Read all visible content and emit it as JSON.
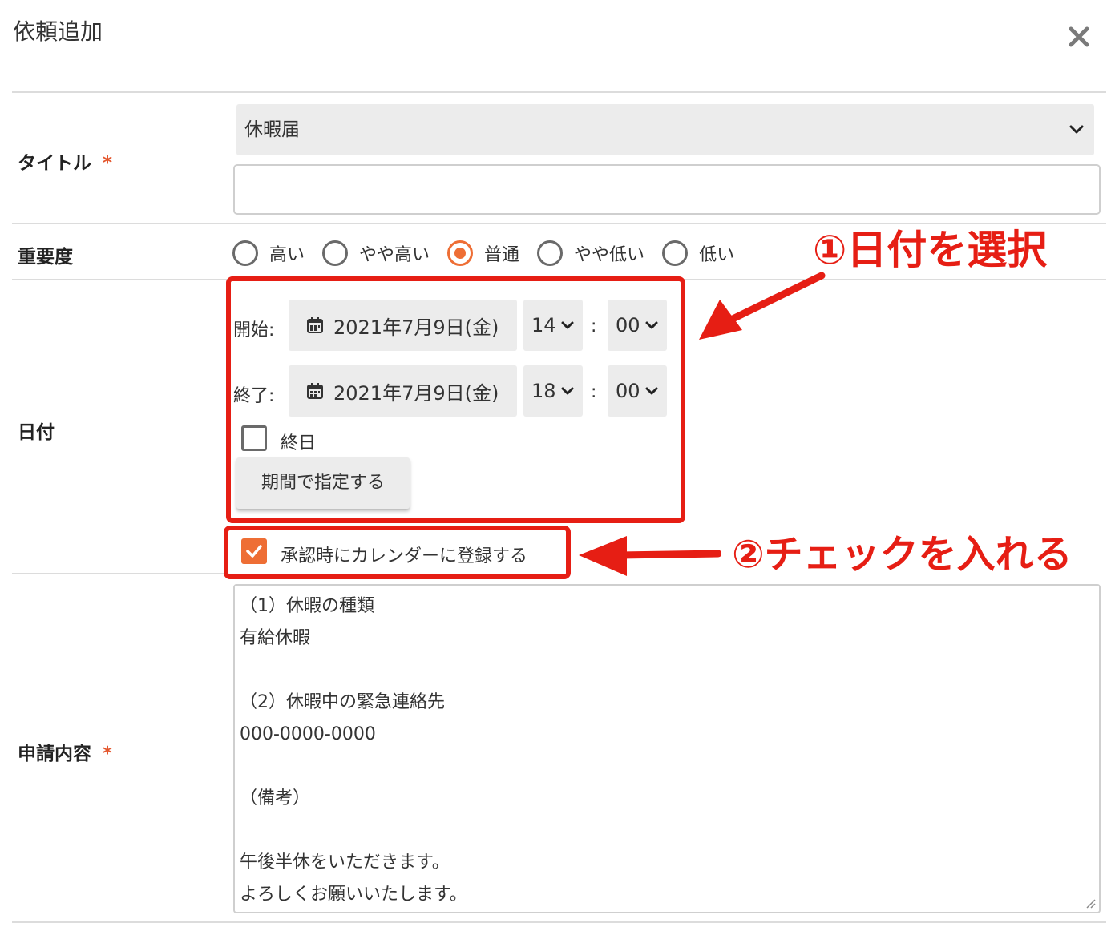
{
  "modal": {
    "title": "依頼追加",
    "close_icon": "close-icon"
  },
  "title_row": {
    "label": "タイトル",
    "required_mark": "*",
    "selected_template": "休暇届",
    "title_input_value": ""
  },
  "priority_row": {
    "label": "重要度",
    "options": [
      "高い",
      "やや高い",
      "普通",
      "やや低い",
      "低い"
    ],
    "selected": "普通"
  },
  "date_row": {
    "label": "日付",
    "start": {
      "label": "開始:",
      "date": "2021年7月9日(金)",
      "hour": "14",
      "minute": "00"
    },
    "end": {
      "label": "終了:",
      "date": "2021年7月9日(金)",
      "hour": "18",
      "minute": "00"
    },
    "colon": ":",
    "all_day_label": "終日",
    "all_day_checked": false,
    "period_button_label": "期間で指定する",
    "calendar_register_label": "承認時にカレンダーに登録する",
    "calendar_register_checked": true
  },
  "content_row": {
    "label": "申請内容",
    "required_mark": "*",
    "lines": [
      "（1）休暇の種類",
      "有給休暇",
      "",
      "（2）休暇中の緊急連絡先",
      "000-0000-0000",
      "",
      "（備考）",
      "",
      "午後半休をいただきます。",
      "よろしくお願いいたします。"
    ]
  },
  "annotations": {
    "step1": "①日付を選択",
    "step2": "②チェックを入れる"
  },
  "colors": {
    "accent": "#ee6e35",
    "annotation_red": "#e61e14",
    "field_bg": "#ececec",
    "divider": "#dcdcdc"
  }
}
